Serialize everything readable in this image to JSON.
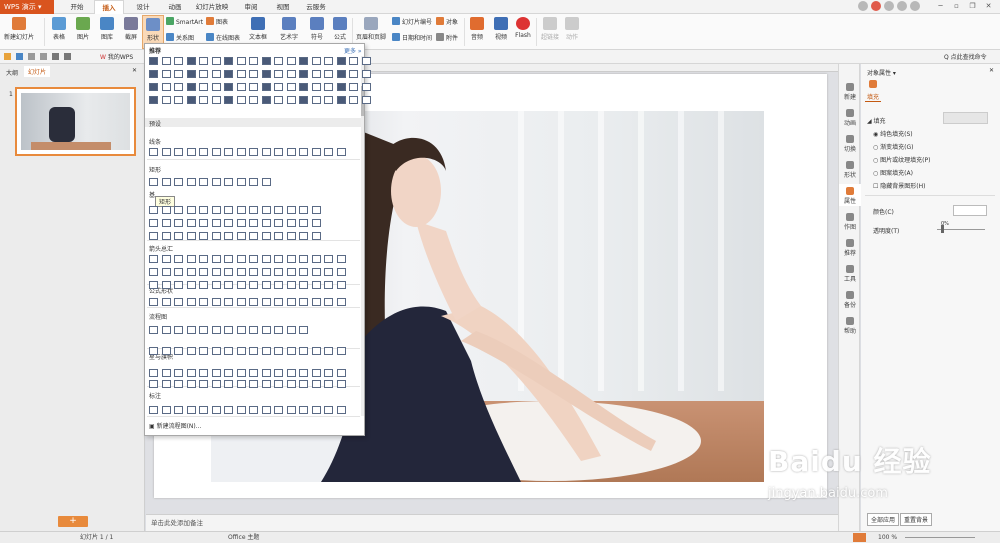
{
  "app": {
    "name": "WPS 演示"
  },
  "menu_tabs": [
    "开始",
    "插入",
    "设计",
    "动画",
    "幻灯片放映",
    "审阅",
    "视图",
    "云服务"
  ],
  "active_tab": "插入",
  "ribbon": {
    "new_slide": "新建幻灯片",
    "table": "表格",
    "picture": "图片",
    "gallery": "图库",
    "screenshot": "截屏",
    "shape": "形状",
    "smartart": "SmartArt",
    "chart": "图表",
    "relation": "关系图",
    "online_chart": "在线图表",
    "textbox": "文本框",
    "art_text": "艺术字",
    "symbol": "符号",
    "formula": "公式",
    "header_footer": "页眉和页脚",
    "slide_number": "幻灯片编号",
    "object": "对象",
    "datetime": "日期和时间",
    "attachment": "附件",
    "audio": "音频",
    "video": "视频",
    "flash": "Flash",
    "hyperlink": "超链接",
    "action": "动作"
  },
  "toolbar2": {
    "my_wps": "我的WPS",
    "hint": "点此查找命令"
  },
  "left_panel": {
    "tab_outline": "大纲",
    "tab_slides": "幻灯片",
    "slide_number": "1"
  },
  "notes": {
    "placeholder": "单击此处添加备注"
  },
  "status": {
    "slide_count": "幻灯片 1 / 1",
    "theme": "Office 主题",
    "zoom": "100 %"
  },
  "sidebar": [
    "新建",
    "动画",
    "切换",
    "形状",
    "属性",
    "作图",
    "推荐",
    "工具",
    "备份",
    "帮助"
  ],
  "right_panel": {
    "title": "对象属性",
    "tab": "填充",
    "section": "填充",
    "options": [
      "纯色填充(S)",
      "渐变填充(G)",
      "图片或纹理填充(P)",
      "图案填充(A)",
      "隐藏背景图形(H)"
    ],
    "color_label": "颜色(C)",
    "transparency_label": "透明度(T)",
    "transparency_value": "0%",
    "apply_all": "全部应用",
    "reset_bg": "重置背景"
  },
  "dropdown": {
    "recommended": "推荐",
    "more": "更多 »",
    "preset": "预设",
    "sections": [
      "线条",
      "矩形",
      "基",
      "箭头总汇",
      "公式形状",
      "流程图",
      "星与旗帜",
      "标注"
    ],
    "tooltip": "矩形",
    "footer": "新建流程图(N)..."
  },
  "watermark": {
    "brand": "Baidu 经验",
    "url": "jingyan.baidu.com"
  },
  "colors": {
    "accent": "#d9541e",
    "tab_active": "#c45911",
    "shape_stroke": "#5a6a85"
  }
}
